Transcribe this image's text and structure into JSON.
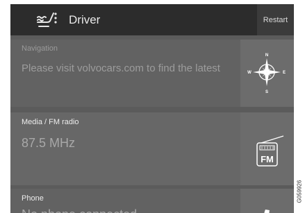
{
  "header": {
    "profile_icon": "seat-settings-icon",
    "profile_name": "Driver",
    "restart_label": "Restart"
  },
  "tiles": [
    {
      "title": "Navigation",
      "subtitle": "Please visit volvocars.com to find the latest",
      "icon": "compass-rose-icon",
      "compass": {
        "n": "N",
        "s": "S",
        "e": "E",
        "w": "W"
      }
    },
    {
      "title": "Media / FM radio",
      "subtitle": "87.5 MHz",
      "icon": "fm-radio-icon",
      "icon_text": "FM"
    },
    {
      "title": "Phone",
      "subtitle": "No phone connected",
      "icon": "phone-icon"
    }
  ],
  "figure_code": "G059926"
}
